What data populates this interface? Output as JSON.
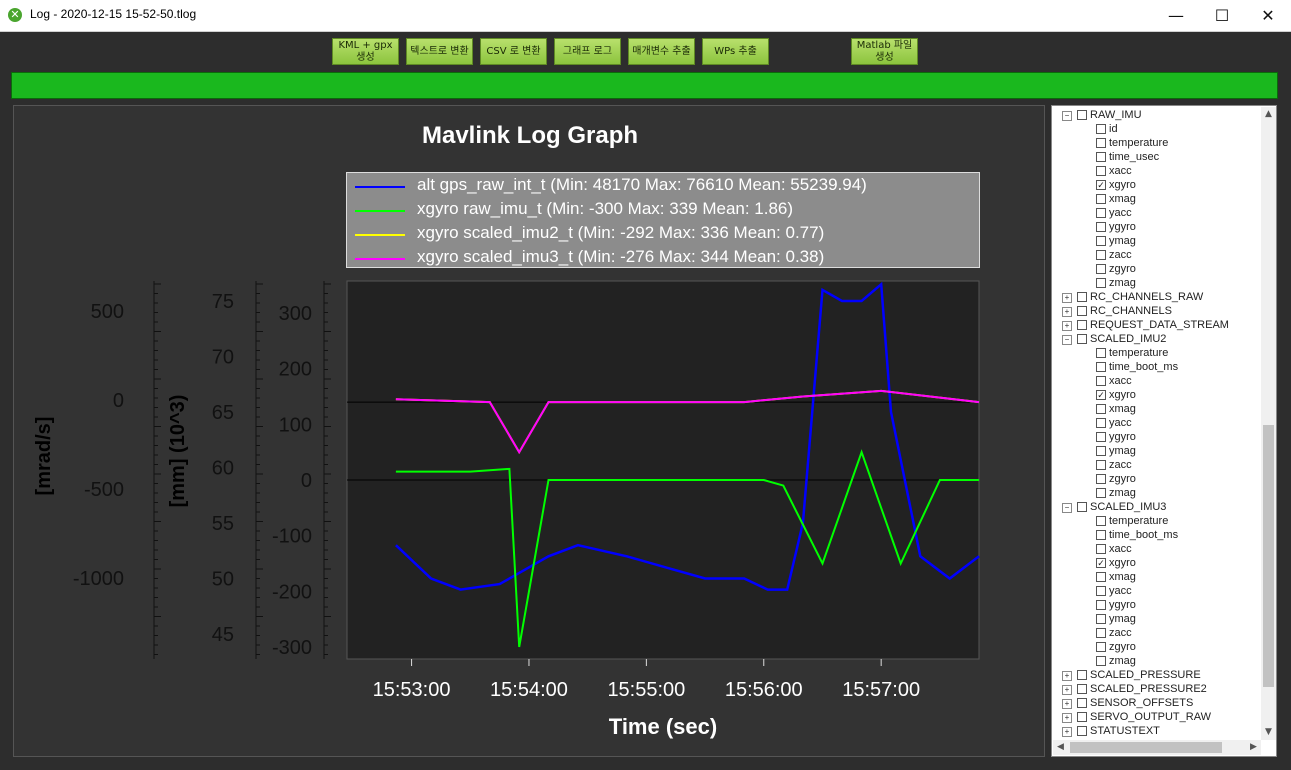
{
  "window": {
    "title": "Log - 2020-12-15 15-52-50.tlog",
    "minimize": "—",
    "maximize": "☐",
    "close": "✕"
  },
  "toolbar": {
    "buttons": [
      "KML + gpx 생성",
      "텍스트로 변환",
      "CSV 로 변환",
      "그래프 로그",
      "매개변수 추출",
      "WPs 추출",
      "Matlab 파일 생성"
    ]
  },
  "progress": {
    "value": 1.0
  },
  "chart_data": {
    "type": "line",
    "title": "Mavlink Log Graph",
    "xlabel": "Time (sec)",
    "x_ticks": [
      "15:53:00",
      "15:54:00",
      "15:55:00",
      "15:56:00",
      "15:57:00"
    ],
    "y_axes": [
      {
        "label": "[mrad/s]",
        "ticks": [
          "500",
          "0",
          "-500",
          "-1000"
        ]
      },
      {
        "label": "[mm] (10^3)",
        "ticks": [
          "75",
          "70",
          "65",
          "60",
          "55",
          "50",
          "45"
        ]
      },
      {
        "label": "",
        "ticks": [
          "300",
          "200",
          "100",
          "0",
          "-100",
          "-200",
          "-300"
        ]
      }
    ],
    "series": [
      {
        "name": "alt gps_raw_int_t (Min: 48170 Max: 76610 Mean: 55239.94)",
        "color": "#0000ff",
        "axis": "mm (10^3)",
        "x": [
          "15:52:52",
          "15:53:10",
          "15:53:25",
          "15:53:45",
          "15:54:10",
          "15:54:25",
          "15:54:50",
          "15:55:10",
          "15:55:30",
          "15:55:50",
          "15:56:02",
          "15:56:12",
          "15:56:20",
          "15:56:30",
          "15:56:40",
          "15:56:50",
          "15:57:00",
          "15:57:05",
          "15:57:20",
          "15:57:35",
          "15:57:50"
        ],
        "y": [
          53,
          50,
          49,
          49.5,
          52,
          53,
          52,
          51,
          50,
          50,
          49,
          49,
          55,
          76,
          75,
          75,
          76.5,
          65,
          52,
          50,
          52
        ]
      },
      {
        "name": "xgyro raw_imu_t (Min: -300 Max: 339 Mean: 1.86)",
        "color": "#00ff00",
        "axis": "right",
        "x": [
          "15:52:52",
          "15:53:30",
          "15:53:50",
          "15:53:55",
          "15:54:00",
          "15:54:10",
          "15:54:40",
          "15:55:10",
          "15:55:40",
          "15:56:00",
          "15:56:10",
          "15:56:30",
          "15:56:50",
          "15:57:10",
          "15:57:30",
          "15:57:50"
        ],
        "y": [
          15,
          15,
          20,
          -300,
          -200,
          0,
          0,
          0,
          0,
          0,
          -10,
          -150,
          50,
          -150,
          0,
          0
        ]
      },
      {
        "name": "xgyro scaled_imu2_t (Min: -292 Max: 336 Mean: 0.77)",
        "color": "#ffff00",
        "axis": "right",
        "x": [
          "15:52:52",
          "15:53:40",
          "15:53:55",
          "15:54:10",
          "15:55:00",
          "15:55:50",
          "15:56:20",
          "15:57:00",
          "15:57:50"
        ],
        "y": [
          145,
          140,
          50,
          140,
          140,
          140,
          150,
          160,
          140
        ]
      },
      {
        "name": "xgyro scaled_imu3_t (Min: -276 Max: 344 Mean: 0.38)",
        "color": "#ff00ff",
        "axis": "right",
        "x": [
          "15:52:52",
          "15:53:40",
          "15:53:55",
          "15:54:10",
          "15:55:00",
          "15:55:50",
          "15:56:20",
          "15:57:00",
          "15:57:50"
        ],
        "y": [
          145,
          140,
          50,
          140,
          140,
          140,
          150,
          160,
          140
        ]
      }
    ],
    "grid": false,
    "legend": "top"
  },
  "tree": {
    "items": [
      {
        "label": "RAW_IMU",
        "level": 0,
        "expanded": true,
        "checked": false
      },
      {
        "label": "id",
        "level": 1,
        "checked": false
      },
      {
        "label": "temperature",
        "level": 1,
        "checked": false
      },
      {
        "label": "time_usec",
        "level": 1,
        "checked": false
      },
      {
        "label": "xacc",
        "level": 1,
        "checked": false
      },
      {
        "label": "xgyro",
        "level": 1,
        "checked": true
      },
      {
        "label": "xmag",
        "level": 1,
        "checked": false
      },
      {
        "label": "yacc",
        "level": 1,
        "checked": false
      },
      {
        "label": "ygyro",
        "level": 1,
        "checked": false
      },
      {
        "label": "ymag",
        "level": 1,
        "checked": false
      },
      {
        "label": "zacc",
        "level": 1,
        "checked": false
      },
      {
        "label": "zgyro",
        "level": 1,
        "checked": false
      },
      {
        "label": "zmag",
        "level": 1,
        "checked": false
      },
      {
        "label": "RC_CHANNELS_RAW",
        "level": 0,
        "expanded": false,
        "checked": false
      },
      {
        "label": "RC_CHANNELS",
        "level": 0,
        "expanded": false,
        "checked": false
      },
      {
        "label": "REQUEST_DATA_STREAM",
        "level": 0,
        "expanded": false,
        "checked": false
      },
      {
        "label": "SCALED_IMU2",
        "level": 0,
        "expanded": true,
        "checked": false
      },
      {
        "label": "temperature",
        "level": 1,
        "checked": false
      },
      {
        "label": "time_boot_ms",
        "level": 1,
        "checked": false
      },
      {
        "label": "xacc",
        "level": 1,
        "checked": false
      },
      {
        "label": "xgyro",
        "level": 1,
        "checked": true
      },
      {
        "label": "xmag",
        "level": 1,
        "checked": false
      },
      {
        "label": "yacc",
        "level": 1,
        "checked": false
      },
      {
        "label": "ygyro",
        "level": 1,
        "checked": false
      },
      {
        "label": "ymag",
        "level": 1,
        "checked": false
      },
      {
        "label": "zacc",
        "level": 1,
        "checked": false
      },
      {
        "label": "zgyro",
        "level": 1,
        "checked": false
      },
      {
        "label": "zmag",
        "level": 1,
        "checked": false
      },
      {
        "label": "SCALED_IMU3",
        "level": 0,
        "expanded": true,
        "checked": false
      },
      {
        "label": "temperature",
        "level": 1,
        "checked": false
      },
      {
        "label": "time_boot_ms",
        "level": 1,
        "checked": false
      },
      {
        "label": "xacc",
        "level": 1,
        "checked": false
      },
      {
        "label": "xgyro",
        "level": 1,
        "checked": true
      },
      {
        "label": "xmag",
        "level": 1,
        "checked": false
      },
      {
        "label": "yacc",
        "level": 1,
        "checked": false
      },
      {
        "label": "ygyro",
        "level": 1,
        "checked": false
      },
      {
        "label": "ymag",
        "level": 1,
        "checked": false
      },
      {
        "label": "zacc",
        "level": 1,
        "checked": false
      },
      {
        "label": "zgyro",
        "level": 1,
        "checked": false
      },
      {
        "label": "zmag",
        "level": 1,
        "checked": false
      },
      {
        "label": "SCALED_PRESSURE",
        "level": 0,
        "expanded": false,
        "checked": false
      },
      {
        "label": "SCALED_PRESSURE2",
        "level": 0,
        "expanded": false,
        "checked": false
      },
      {
        "label": "SENSOR_OFFSETS",
        "level": 0,
        "expanded": false,
        "checked": false
      },
      {
        "label": "SERVO_OUTPUT_RAW",
        "level": 0,
        "expanded": false,
        "checked": false
      },
      {
        "label": "STATUSTEXT",
        "level": 0,
        "expanded": false,
        "checked": false
      }
    ]
  }
}
